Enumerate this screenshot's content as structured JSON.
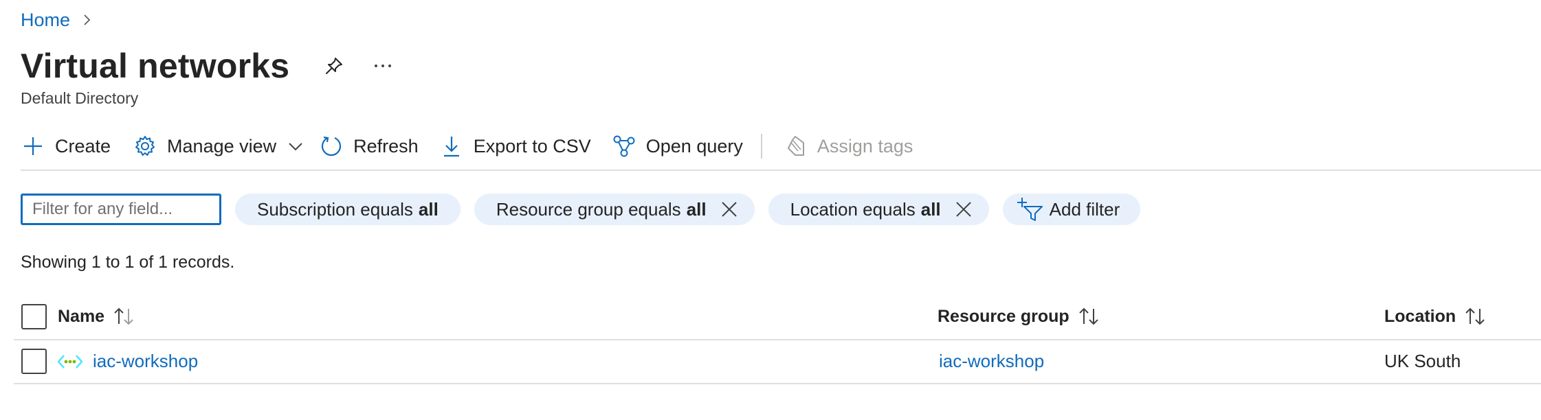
{
  "breadcrumb": {
    "home": "Home"
  },
  "page": {
    "title": "Virtual networks",
    "subtitle": "Default Directory",
    "more_label": "···"
  },
  "toolbar": {
    "create": "Create",
    "manage_view": "Manage view",
    "refresh": "Refresh",
    "export_csv": "Export to CSV",
    "open_query": "Open query",
    "assign_tags": "Assign tags"
  },
  "filters": {
    "search_placeholder": "Filter for any field...",
    "search_value": "",
    "subscription": {
      "label": "Subscription equals",
      "value": "all"
    },
    "resource_group": {
      "label": "Resource group equals",
      "value": "all"
    },
    "location": {
      "label": "Location equals",
      "value": "all"
    },
    "add_filter": "Add filter"
  },
  "records_text": "Showing 1 to 1 of 1 records.",
  "table": {
    "columns": {
      "name": "Name",
      "resource_group": "Resource group",
      "location": "Location"
    },
    "rows": [
      {
        "name": "iac-workshop",
        "resource_group": "iac-workshop",
        "location": "UK South"
      }
    ]
  },
  "colors": {
    "accent": "#0f6cbd",
    "pill_background": "#e8f1fb",
    "text": "#242424",
    "disabled": "#a19f9d",
    "vnet_icon_blue": "#50e6ff",
    "vnet_icon_green": "#7fba00"
  },
  "icons": [
    "chevron-right-icon",
    "pin-icon",
    "more-icon",
    "plus-icon",
    "gear-icon",
    "chevron-down-icon",
    "refresh-icon",
    "download-icon",
    "query-icon",
    "tag-icon",
    "close-icon",
    "add-filter-icon",
    "sort-icon",
    "virtual-network-icon"
  ]
}
